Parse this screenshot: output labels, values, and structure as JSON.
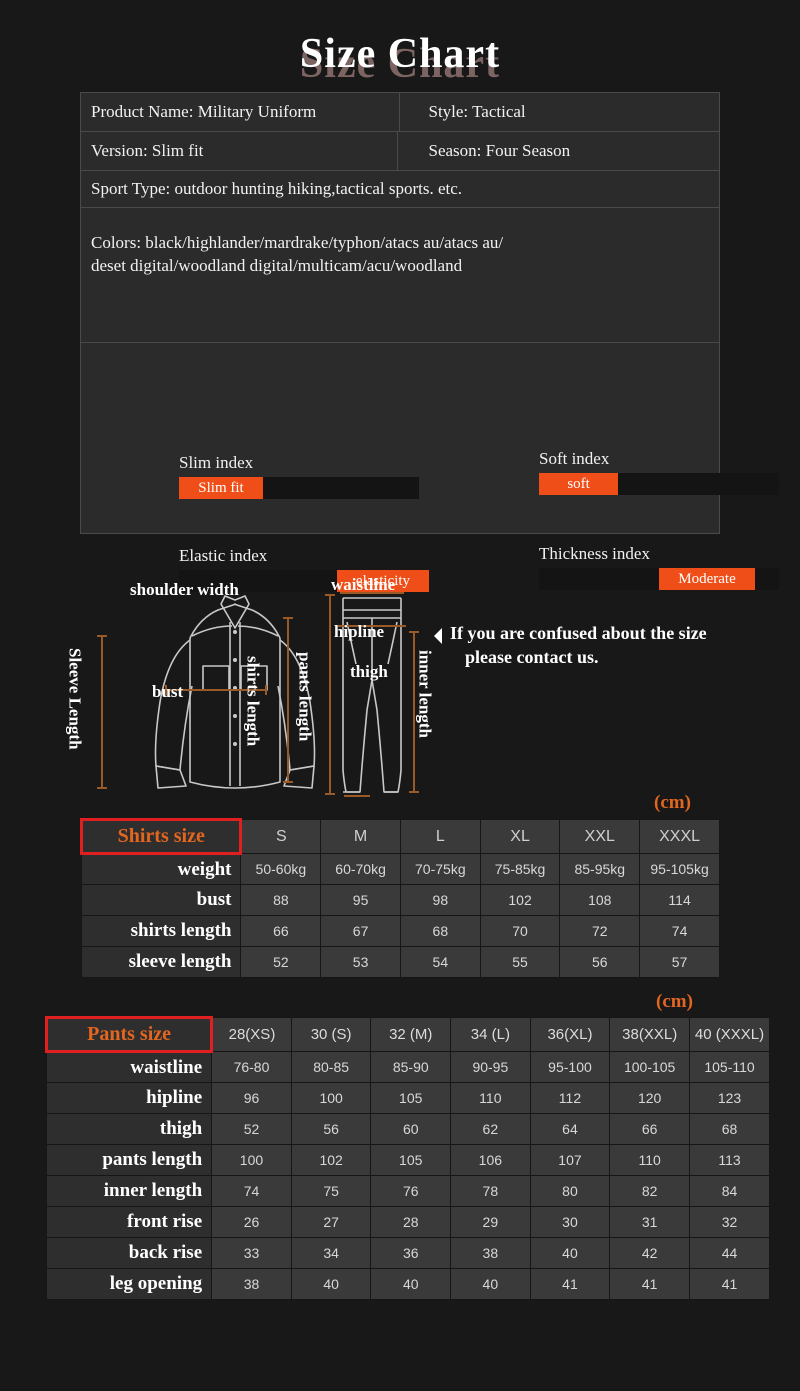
{
  "title": {
    "text": "Size Chart"
  },
  "info": {
    "product_name": "Product Name: Military Uniform",
    "style": "Style: Tactical",
    "version": "Version: Slim fit",
    "season": "Season: Four Season",
    "sport_type": "Sport Type: outdoor hunting hiking,tactical sports. etc.",
    "colors_line1": "Colors: black/highlander/mardrake/typhon/atacs au/atacs au/",
    "colors_line2": "deset digital/woodland digital/multicam/acu/woodland"
  },
  "indices": [
    {
      "label": "Slim index",
      "value": "Slim fit",
      "fill_left_pct": 0,
      "fill_width_pct": 35
    },
    {
      "label": "Soft index",
      "value": "soft",
      "fill_left_pct": 0,
      "fill_width_pct": 33
    },
    {
      "label": "Elastic index",
      "value": "elasticity",
      "fill_left_pct": 66,
      "fill_width_pct": 38
    },
    {
      "label": "Thickness index",
      "value": "Moderate",
      "fill_left_pct": 50,
      "fill_width_pct": 40
    }
  ],
  "diagram": {
    "shoulder_width": "shoulder width",
    "sleeve_length": "Sleeve Length",
    "bust": "bust",
    "shirts_length": "shirts length",
    "waistline": "waistline",
    "hipline": "hipline",
    "thigh": "thigh",
    "pants_length": "pants length",
    "inner_length": "inner length",
    "contact_line1": "If you are confused about the size",
    "contact_line2": "please contact us."
  },
  "shirts": {
    "unit": "(cm)",
    "corner": "Shirts size",
    "sizes": [
      "S",
      "M",
      "L",
      "XL",
      "XXL",
      "XXXL"
    ],
    "rows": [
      {
        "label": "weight",
        "values": [
          "50-60kg",
          "60-70kg",
          "70-75kg",
          "75-85kg",
          "85-95kg",
          "95-105kg"
        ]
      },
      {
        "label": "bust",
        "values": [
          "88",
          "95",
          "98",
          "102",
          "108",
          "114"
        ]
      },
      {
        "label": "shirts length",
        "values": [
          "66",
          "67",
          "68",
          "70",
          "72",
          "74"
        ]
      },
      {
        "label": "sleeve length",
        "values": [
          "52",
          "53",
          "54",
          "55",
          "56",
          "57"
        ]
      }
    ]
  },
  "pants": {
    "unit": "(cm)",
    "corner": "Pants size",
    "sizes": [
      "28(XS)",
      "30 (S)",
      "32 (M)",
      "34 (L)",
      "36(XL)",
      "38(XXL)",
      "40 (XXXL)"
    ],
    "rows": [
      {
        "label": "waistline",
        "values": [
          "76-80",
          "80-85",
          "85-90",
          "90-95",
          "95-100",
          "100-105",
          "105-110"
        ]
      },
      {
        "label": "hipline",
        "values": [
          "96",
          "100",
          "105",
          "110",
          "112",
          "120",
          "123"
        ]
      },
      {
        "label": "thigh",
        "values": [
          "52",
          "56",
          "60",
          "62",
          "64",
          "66",
          "68"
        ]
      },
      {
        "label": "pants length",
        "values": [
          "100",
          "102",
          "105",
          "106",
          "107",
          "110",
          "113"
        ]
      },
      {
        "label": "inner length",
        "values": [
          "74",
          "75",
          "76",
          "78",
          "80",
          "82",
          "84"
        ]
      },
      {
        "label": "front rise",
        "values": [
          "26",
          "27",
          "28",
          "29",
          "30",
          "31",
          "32"
        ]
      },
      {
        "label": "back rise",
        "values": [
          "33",
          "34",
          "36",
          "38",
          "40",
          "42",
          "44"
        ]
      },
      {
        "label": "leg opening",
        "values": [
          "38",
          "40",
          "40",
          "40",
          "41",
          "41",
          "41"
        ]
      }
    ]
  },
  "colors": {
    "accent_orange": "#f04e18",
    "label_orange": "#e2661f",
    "corner_border_red": "#e02020",
    "background": "#181818",
    "diagram_line": "#c8c8c8",
    "measure_line": "#9a5a28"
  }
}
